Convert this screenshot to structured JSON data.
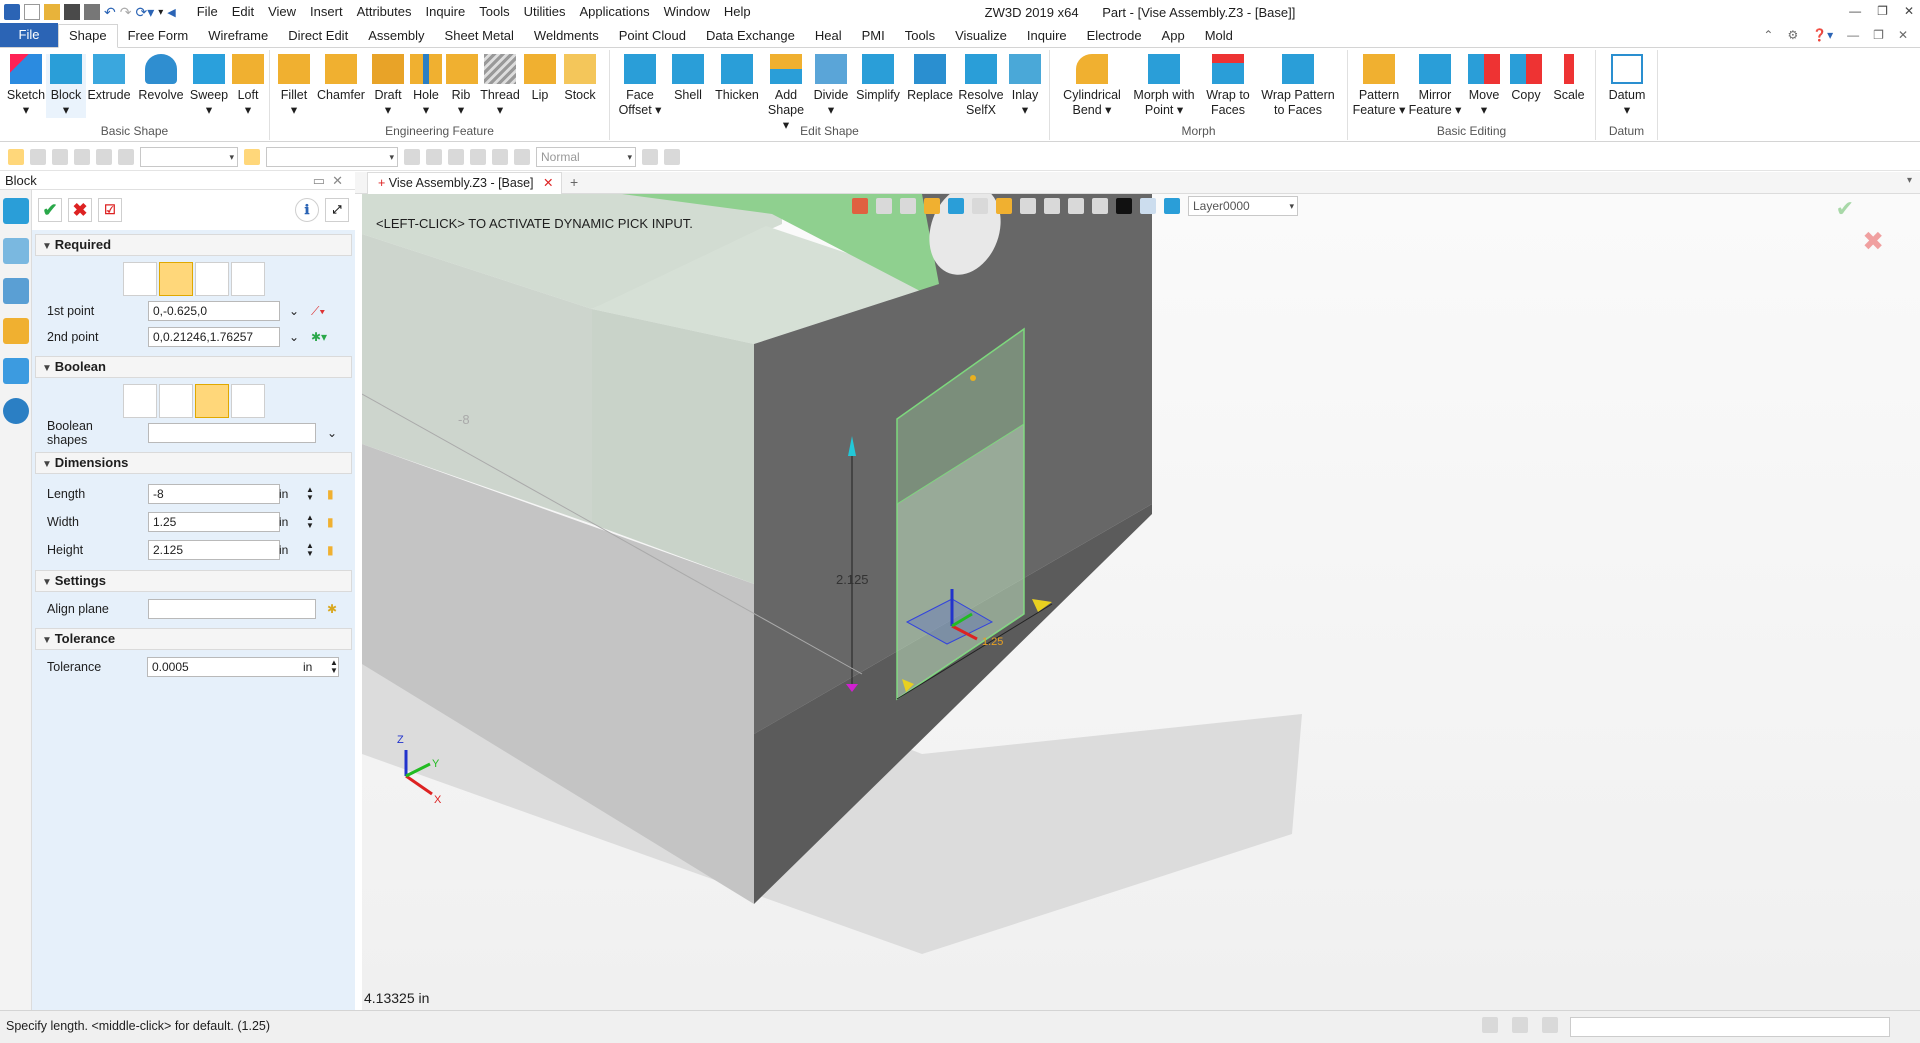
{
  "titlebar": {
    "menu": [
      "File",
      "Edit",
      "View",
      "Insert",
      "Attributes",
      "Inquire",
      "Tools",
      "Utilities",
      "Applications",
      "Window",
      "Help"
    ],
    "app": "ZW3D 2019  x64",
    "doc": "Part - [Vise Assembly.Z3 - [Base]]"
  },
  "tabs": [
    "File",
    "Shape",
    "Free Form",
    "Wireframe",
    "Direct Edit",
    "Assembly",
    "Sheet Metal",
    "Weldments",
    "Point Cloud",
    "Data Exchange",
    "Heal",
    "PMI",
    "Tools",
    "Visualize",
    "Inquire",
    "Electrode",
    "App",
    "Mold"
  ],
  "ribbon": {
    "groups": {
      "basic_shape": "Basic Shape",
      "engineering": "Engineering Feature",
      "edit_shape": "Edit Shape",
      "morph": "Morph",
      "basic_editing": "Basic Editing",
      "datum": "Datum"
    },
    "buttons": [
      {
        "l1": "Sketch",
        "l2": "▾"
      },
      {
        "l1": "Block",
        "l2": "▾"
      },
      {
        "l1": "Extrude",
        "l2": ""
      },
      {
        "l1": "Revolve",
        "l2": ""
      },
      {
        "l1": "Sweep",
        "l2": "▾"
      },
      {
        "l1": "Loft",
        "l2": "▾"
      },
      {
        "l1": "Fillet",
        "l2": "▾"
      },
      {
        "l1": "Chamfer",
        "l2": ""
      },
      {
        "l1": "Draft",
        "l2": "▾"
      },
      {
        "l1": "Hole",
        "l2": "▾"
      },
      {
        "l1": "Rib",
        "l2": "▾"
      },
      {
        "l1": "Thread",
        "l2": "▾"
      },
      {
        "l1": "Lip",
        "l2": ""
      },
      {
        "l1": "Stock",
        "l2": ""
      },
      {
        "l1": "Face",
        "l2": "Offset ▾"
      },
      {
        "l1": "Shell",
        "l2": ""
      },
      {
        "l1": "Thicken",
        "l2": ""
      },
      {
        "l1": "Add",
        "l2": "Shape ▾"
      },
      {
        "l1": "Divide",
        "l2": "▾"
      },
      {
        "l1": "Simplify",
        "l2": ""
      },
      {
        "l1": "Replace",
        "l2": ""
      },
      {
        "l1": "Resolve",
        "l2": "SelfX"
      },
      {
        "l1": "Inlay",
        "l2": "▾"
      },
      {
        "l1": "Cylindrical",
        "l2": "Bend ▾"
      },
      {
        "l1": "Morph with",
        "l2": "Point ▾"
      },
      {
        "l1": "Wrap to",
        "l2": "Faces"
      },
      {
        "l1": "Wrap Pattern",
        "l2": "to Faces"
      },
      {
        "l1": "Pattern",
        "l2": "Feature ▾"
      },
      {
        "l1": "Mirror",
        "l2": "Feature ▾"
      },
      {
        "l1": "Move",
        "l2": "▾"
      },
      {
        "l1": "Copy",
        "l2": ""
      },
      {
        "l1": "Scale",
        "l2": ""
      },
      {
        "l1": "Datum",
        "l2": "▾"
      }
    ]
  },
  "qbar": {
    "render_mode": "Normal"
  },
  "panel": {
    "title": "Block",
    "sections": {
      "required": "Required",
      "boolean": "Boolean",
      "dimensions": "Dimensions",
      "settings": "Settings",
      "tolerance": "Tolerance"
    },
    "required": {
      "p1_label": "1st point",
      "p1_value": "0,-0.625,0",
      "p2_label": "2nd point",
      "p2_value": "0,0.21246,1.76257"
    },
    "boolean": {
      "shapes_label": "Boolean shapes",
      "shapes_value": ""
    },
    "dims": {
      "length_label": "Length",
      "length_value": "-8",
      "length_unit": "in",
      "width_label": "Width",
      "width_value": "1.25",
      "width_unit": "in",
      "height_label": "Height",
      "height_value": "2.125",
      "height_unit": "in"
    },
    "settings": {
      "align_label": "Align plane",
      "align_value": ""
    },
    "tolerance": {
      "label": "Tolerance",
      "value": "0.0005",
      "unit": "in"
    }
  },
  "viewport": {
    "tab_label": "Vise Assembly.Z3 - [Base]",
    "hint": "<LEFT-CLICK> TO ACTIVATE DYNAMIC PICK INPUT.",
    "layer": "Layer0000",
    "readout": "4.13325 in",
    "dim_length": "-8",
    "dim_height": "2.125",
    "dim_width": "1.25",
    "axis": {
      "x": "X",
      "y": "Y",
      "z": "Z"
    }
  },
  "status": {
    "message": "Specify length.  <middle-click> for default. (1.25)"
  },
  "colors": {
    "accent": "#2b64b5",
    "selected": "#ffd77a",
    "preview_green": "#7dd87d"
  }
}
